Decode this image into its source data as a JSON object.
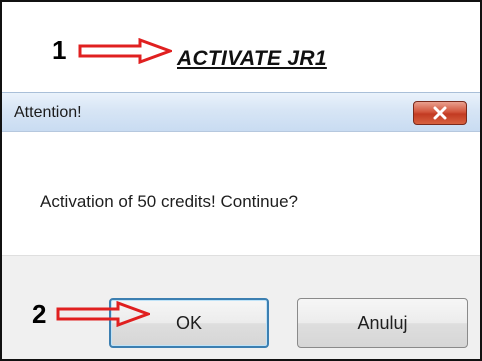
{
  "annotations": {
    "step1_number": "1",
    "step2_number": "2",
    "arrow_color": "#e02020"
  },
  "link": {
    "label": "ACTIVATE JR1"
  },
  "dialog": {
    "title": "Attention!",
    "close_icon": "close-x-icon",
    "message": "Activation of 50 credits! Continue?",
    "ok_label": "OK",
    "cancel_label": "Anuluj",
    "close_button_color": "#c9452b",
    "titlebar_color": "#d7e5f5"
  }
}
